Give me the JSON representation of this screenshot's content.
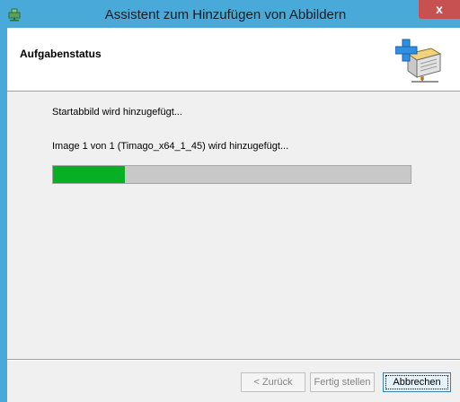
{
  "window": {
    "title": "Assistent zum Hinzufügen von Abbildern",
    "close_label": "x",
    "app_icon": "wds-app-icon"
  },
  "header": {
    "title": "Aufgabenstatus",
    "icon": "add-image-wizard-icon"
  },
  "status": {
    "line1": "Startabbild wird hinzugefügt...",
    "line2": "Image 1 von 1 (Timago_x64_1_45) wird hinzugefügt..."
  },
  "progress": {
    "value": 0.2,
    "color": "#06b025"
  },
  "buttons": {
    "back": "< Zurück",
    "finish": "Fertig stellen",
    "cancel": "Abbrechen"
  },
  "colors": {
    "titlebar": "#49a9d9",
    "close": "#c75050",
    "client": "#f0f0f0"
  }
}
